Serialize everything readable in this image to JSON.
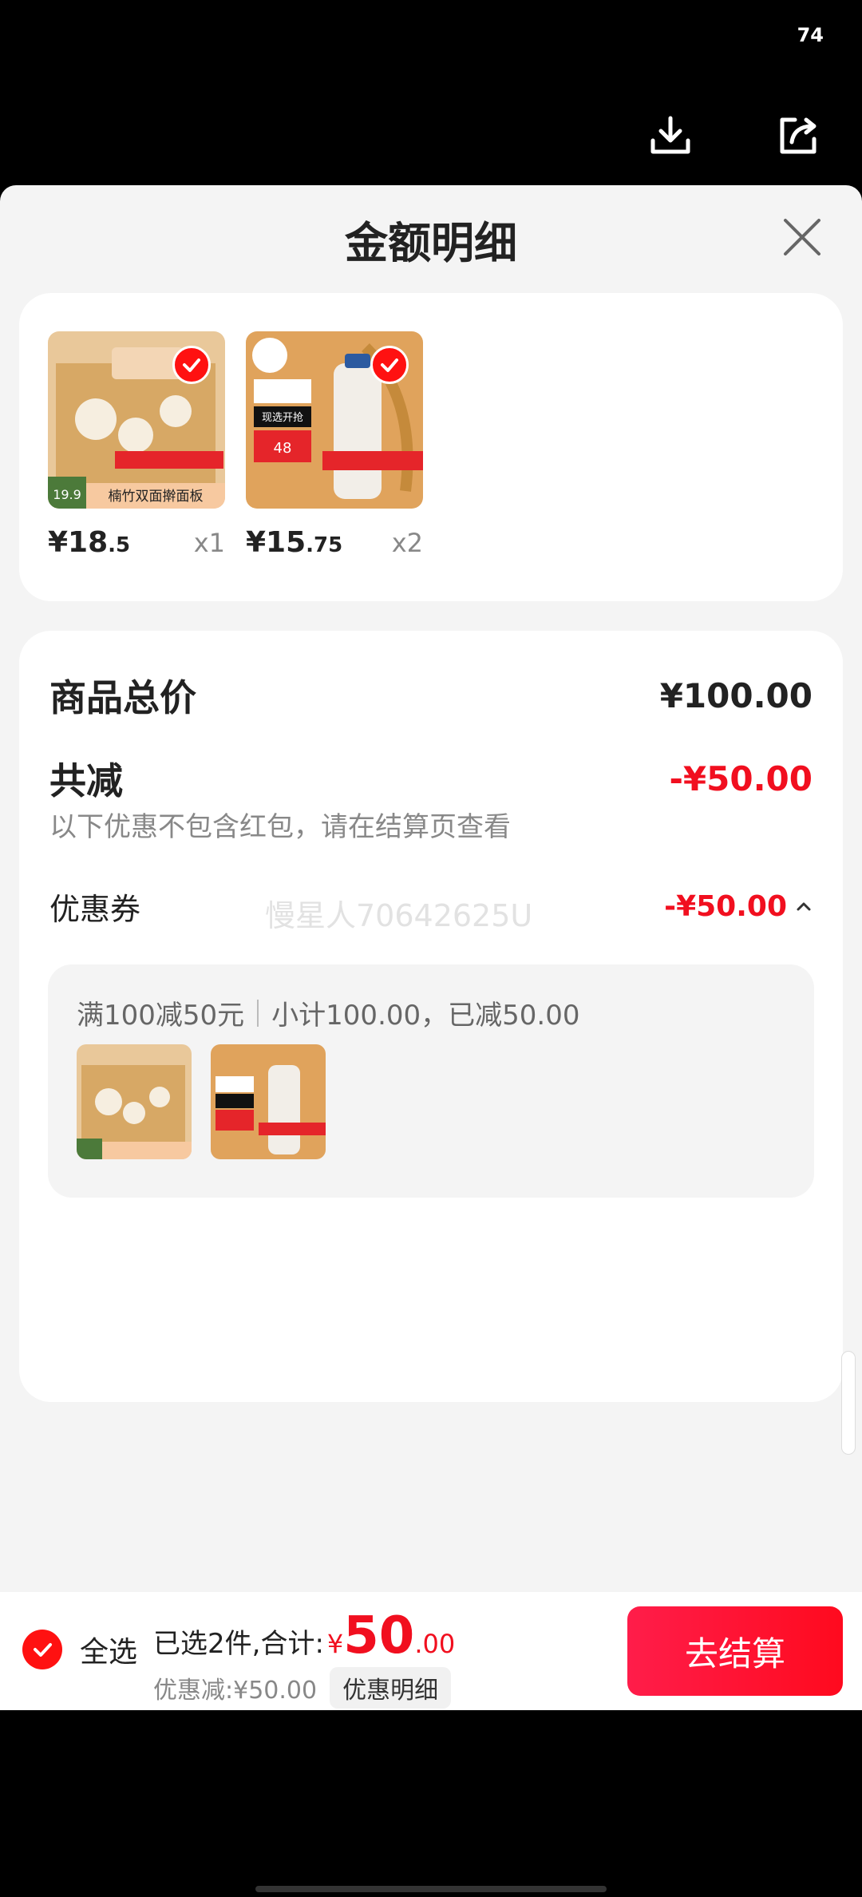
{
  "status_bar": {
    "battery": "74"
  },
  "sheet": {
    "title": "金额明细"
  },
  "products": [
    {
      "price_int": "¥18",
      "price_dec": ".5",
      "qty": "x1",
      "img_caption": "楠竹双面擀面板",
      "img_price": "19.9"
    },
    {
      "price_int": "¥15",
      "price_dec": ".75",
      "qty": "x2",
      "img_caption": "现选开抢",
      "img_price": "48"
    }
  ],
  "summary": {
    "total_label": "商品总价",
    "total_value": "¥100.00",
    "reduce_label": "共减",
    "reduce_value": "-¥50.00",
    "note": "以下优惠不包含红包，请在结算页查看",
    "coupon_label": "优惠券",
    "coupon_value": "-¥50.00",
    "watermark": "慢星人70642625U",
    "coupon_rule": "满100减50元",
    "coupon_subtotal": "小计100.00，已减50.00"
  },
  "bottom_bar": {
    "select_all": "全选",
    "selected_text": "已选2件,合计:",
    "currency": "¥",
    "total_int": "50",
    "total_dec": ".00",
    "discount_text": "优惠减:¥50.00",
    "detail_button": "优惠明细",
    "checkout_button": "去结算"
  },
  "colors": {
    "accent_red": "#f10f1f",
    "sheet_bg": "#f4f4f4"
  },
  "icons": [
    "download-icon",
    "share-icon",
    "close-icon",
    "check-icon",
    "chevron-up-icon"
  ]
}
